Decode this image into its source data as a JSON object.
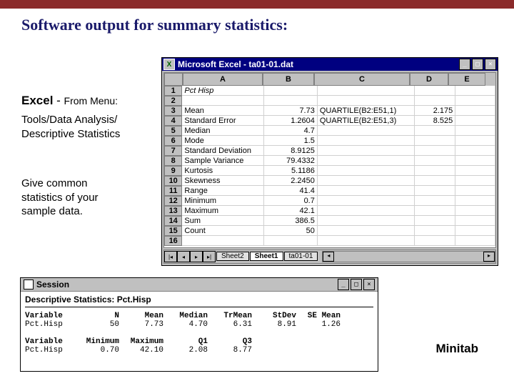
{
  "slide": {
    "title": "Software output for summary statistics:"
  },
  "left": {
    "excel_head_bold": "Excel",
    "excel_head_dash": " - ",
    "excel_head_sub": "From Menu:",
    "menu_path1": "Tools/Data Analysis/",
    "menu_path2": "Descriptive Statistics",
    "desc1": "Give common",
    "desc2": "statistics of your",
    "desc3": "sample data."
  },
  "excel": {
    "titlebar": "Microsoft Excel - ta01-01.dat",
    "columns": [
      "A",
      "B",
      "C",
      "D",
      "E"
    ],
    "rows": [
      {
        "n": "1",
        "A": "Pct Hisp",
        "Ait": true
      },
      {
        "n": "2"
      },
      {
        "n": "3",
        "A": "Mean",
        "B": "7.73",
        "C": "QUARTILE(B2:E51,1)",
        "D": "2.175"
      },
      {
        "n": "4",
        "A": "Standard Error",
        "B": "1.2604",
        "C": "QUARTILE(B2:E51,3)",
        "D": "8.525"
      },
      {
        "n": "5",
        "A": "Median",
        "B": "4.7"
      },
      {
        "n": "6",
        "A": "Mode",
        "B": "1.5"
      },
      {
        "n": "7",
        "A": "Standard Deviation",
        "B": "8.9125"
      },
      {
        "n": "8",
        "A": "Sample Variance",
        "B": "79.4332"
      },
      {
        "n": "9",
        "A": "Kurtosis",
        "B": "5.1186"
      },
      {
        "n": "10",
        "A": "Skewness",
        "B": "2.2450"
      },
      {
        "n": "11",
        "A": "Range",
        "B": "41.4"
      },
      {
        "n": "12",
        "A": "Minimum",
        "B": "0.7"
      },
      {
        "n": "13",
        "A": "Maximum",
        "B": "42.1"
      },
      {
        "n": "14",
        "A": "Sum",
        "B": "386.5"
      },
      {
        "n": "15",
        "A": "Count",
        "B": "50"
      },
      {
        "n": "16"
      }
    ],
    "tabs": [
      "Sheet2",
      "Sheet1",
      "ta01-01"
    ],
    "active_tab": 1
  },
  "minitab": {
    "window_title": "Session",
    "heading": "Descriptive Statistics: Pct.Hisp",
    "label": "Minitab",
    "rows": [
      {
        "var": "Variable",
        "c1": "N",
        "c2": "Mean",
        "c3": "Median",
        "c4": "TrMean",
        "c5": "StDev",
        "c6": "SE Mean",
        "hdr": true
      },
      {
        "var": "Pct.Hisp",
        "c1": "50",
        "c2": "7.73",
        "c3": "4.70",
        "c4": "6.31",
        "c5": "8.91",
        "c6": "1.26"
      },
      {
        "blank": true
      },
      {
        "var": "Variable",
        "c1": "Minimum",
        "c2": "Maximum",
        "c3": "Q1",
        "c4": "Q3",
        "hdr": true
      },
      {
        "var": "Pct.Hisp",
        "c1": "0.70",
        "c2": "42.10",
        "c3": "2.08",
        "c4": "8.77"
      }
    ]
  }
}
